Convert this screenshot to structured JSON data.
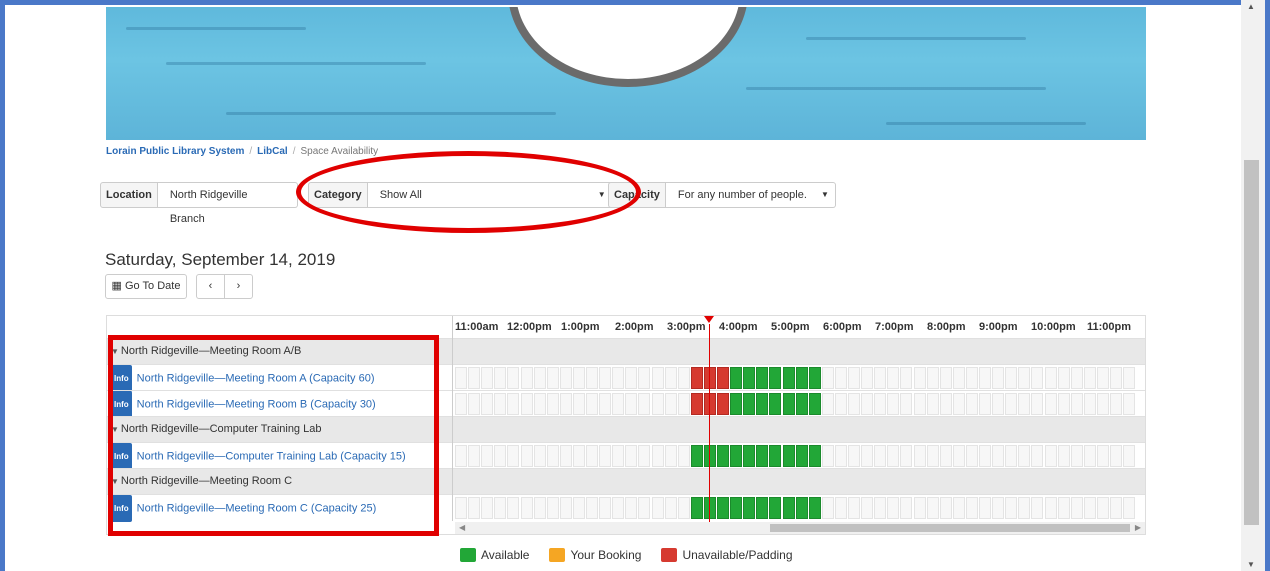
{
  "breadcrumb": {
    "items": [
      "Lorain Public Library System",
      "LibCal",
      "Space Availability"
    ]
  },
  "filters": {
    "location_label": "Location",
    "location_value": "North Ridgeville Branch",
    "category_label": "Category",
    "category_value": "Show All",
    "capacity_label": "Capacity",
    "capacity_value": "For any number of people."
  },
  "date_heading": "Saturday, September 14, 2019",
  "buttons": {
    "go_to_date": "Go To Date",
    "prev": "‹",
    "next": "›"
  },
  "times": [
    "11:00am",
    "12:00pm",
    "1:00pm",
    "2:00pm",
    "3:00pm",
    "4:00pm",
    "5:00pm",
    "6:00pm",
    "7:00pm",
    "8:00pm",
    "9:00pm",
    "10:00pm",
    "11:00pm"
  ],
  "rows": [
    {
      "type": "group",
      "label": "North Ridgeville—Meeting Room A/B"
    },
    {
      "type": "room",
      "label": "North Ridgeville—Meeting Room A (Capacity 60)",
      "info": "Info",
      "unavailable_slots": 3,
      "available_slots": 7
    },
    {
      "type": "room",
      "label": "North Ridgeville—Meeting Room B (Capacity 30)",
      "info": "Info",
      "unavailable_slots": 3,
      "available_slots": 7
    },
    {
      "type": "group",
      "label": "North Ridgeville—Computer Training Lab"
    },
    {
      "type": "room",
      "label": "North Ridgeville—Computer Training Lab (Capacity 15)",
      "info": "Info",
      "unavailable_slots": 0,
      "available_slots": 10
    },
    {
      "type": "group",
      "label": "North Ridgeville—Meeting Room C"
    },
    {
      "type": "room",
      "label": "North Ridgeville—Meeting Room C (Capacity 25)",
      "info": "Info",
      "unavailable_slots": 0,
      "available_slots": 10
    }
  ],
  "legend": [
    {
      "label": "Available",
      "color": "#22a737"
    },
    {
      "label": "Your Booking",
      "color": "#f5a623"
    },
    {
      "label": "Unavailable/Padding",
      "color": "#d63a30"
    }
  ],
  "colors": {
    "accent": "#2a6ab5",
    "highlight": "#e00000",
    "available": "#22a737",
    "unavailable": "#d63a30"
  },
  "icons": {
    "calendar": "calendar-icon",
    "prev": "chevron-left-icon",
    "next": "chevron-right-icon",
    "caret": "caret-down-icon"
  }
}
